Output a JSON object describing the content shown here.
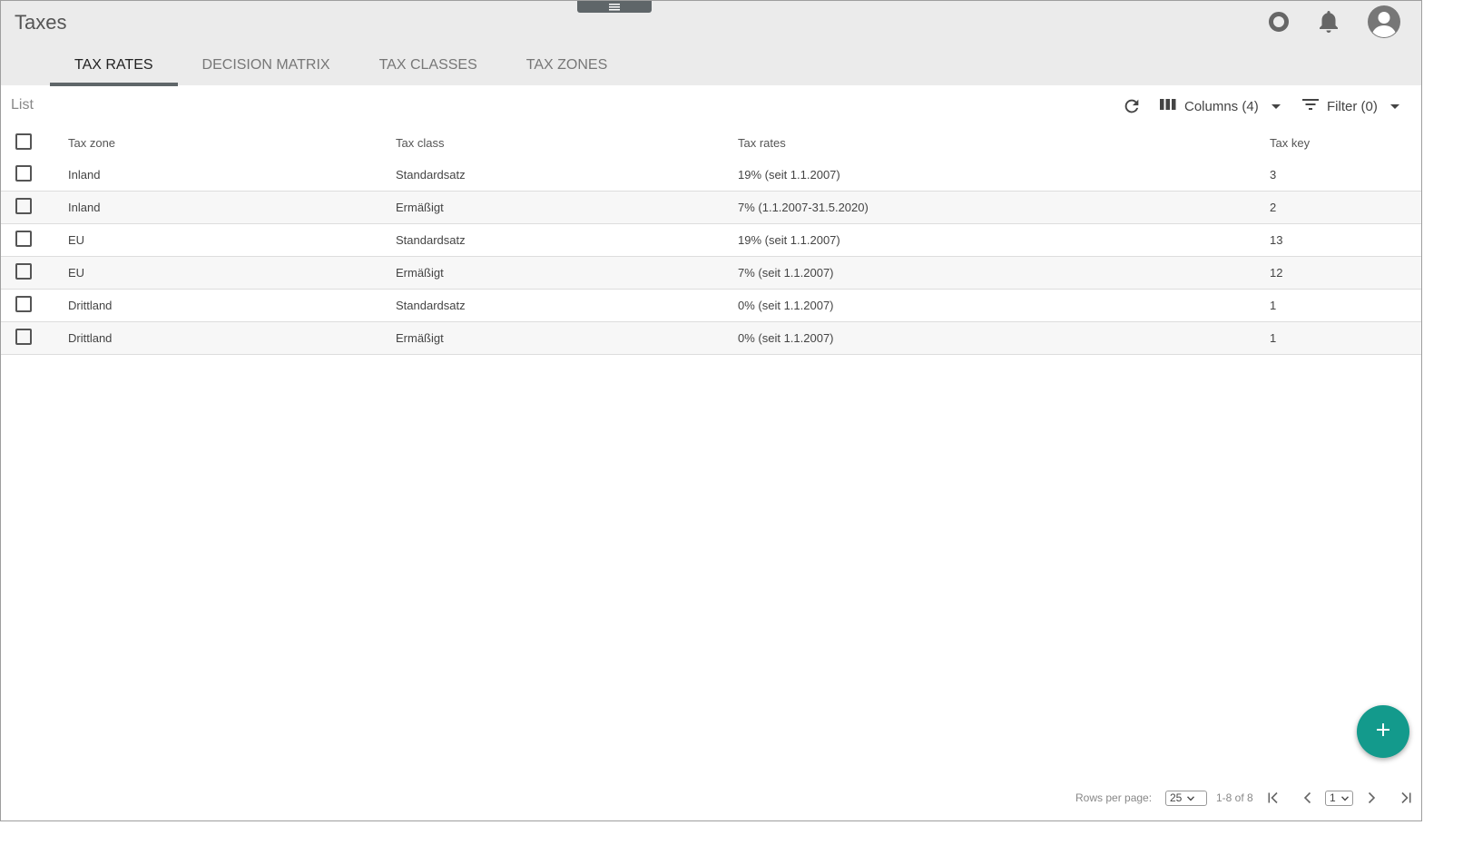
{
  "app": {
    "title": "Taxes"
  },
  "tabs": [
    {
      "label": "TAX RATES",
      "active": true
    },
    {
      "label": "DECISION MATRIX",
      "active": false
    },
    {
      "label": "TAX CLASSES",
      "active": false
    },
    {
      "label": "TAX ZONES",
      "active": false
    }
  ],
  "list": {
    "label": "List",
    "columns_label": "Columns (4)",
    "filter_label": "Filter (0)"
  },
  "table": {
    "headers": [
      "Tax zone",
      "Tax class",
      "Tax rates",
      "Tax key"
    ],
    "rows": [
      [
        "Inland",
        "Standardsatz",
        "19% (seit 1.1.2007)",
        "3"
      ],
      [
        "Inland",
        "Ermäßigt",
        "7% (1.1.2007-31.5.2020)",
        "2"
      ],
      [
        "EU",
        "Standardsatz",
        "19% (seit 1.1.2007)",
        "13"
      ],
      [
        "EU",
        "Ermäßigt",
        "7% (seit 1.1.2007)",
        "12"
      ],
      [
        "Drittland",
        "Standardsatz",
        "0% (seit 1.1.2007)",
        "1"
      ],
      [
        "Drittland",
        "Ermäßigt",
        "0% (seit 1.1.2007)",
        "1"
      ]
    ]
  },
  "pagination": {
    "rows_per_page_label": "Rows per page:",
    "rows_per_page_value": "25",
    "range_label": "1-8 of 8",
    "page_value": "1"
  },
  "icons": {
    "handle": "menu-handle-icon",
    "status": "status-circle-icon",
    "notifications": "bell-icon",
    "user": "avatar-icon",
    "refresh": "refresh-icon",
    "columns": "columns-icon",
    "filter": "filter-icon",
    "add": "plus-icon"
  },
  "colors": {
    "accent": "#139a8c",
    "topbar": "#ebebeb",
    "tab_indicator": "#5f6669"
  }
}
